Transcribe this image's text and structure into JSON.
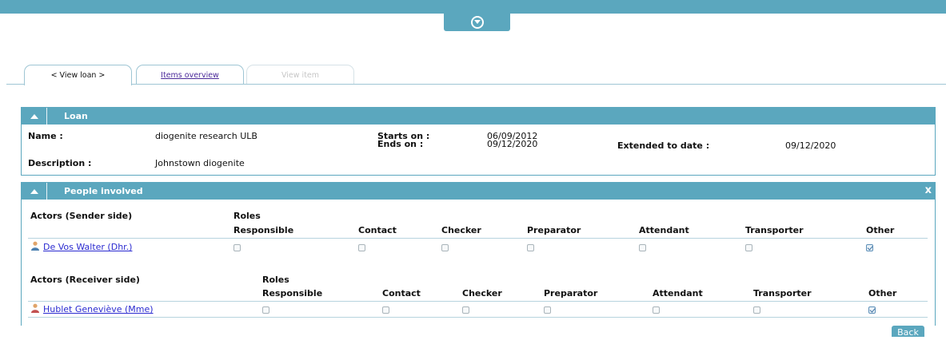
{
  "tabs": [
    {
      "label": "< View loan >"
    },
    {
      "label": "Items overview"
    },
    {
      "label": "View item"
    }
  ],
  "loan": {
    "title": "Loan",
    "name_label": "Name :",
    "name_value": "diogenite research ULB",
    "starts_label": "Starts on :",
    "starts_value": "06/09/2012",
    "ends_label": "Ends on :",
    "ends_value": "09/12/2020",
    "extended_label": "Extended to date :",
    "extended_value": "09/12/2020",
    "description_label": "Description :",
    "description_value": "Johnstown diogenite"
  },
  "people": {
    "title": "People involved",
    "close_label": "x",
    "roles_label": "Roles",
    "role_headers": [
      "Responsible",
      "Contact",
      "Checker",
      "Preparator",
      "Attendant",
      "Transporter",
      "Other"
    ],
    "sender": {
      "header": "Actors (Sender side)",
      "actor": "De Vos Walter (Dhr.)",
      "roles_checked": [
        false,
        false,
        false,
        false,
        false,
        false,
        true
      ]
    },
    "receiver": {
      "header": "Actors (Receiver side)",
      "actor": "Hublet Geneviève (Mme)",
      "roles_checked": [
        false,
        false,
        false,
        false,
        false,
        false,
        true
      ]
    }
  },
  "back_label": "Back",
  "icons": {
    "toggle": "chevron-down-circle-icon",
    "collapse": "triangle-up-icon",
    "person_male": "person-icon",
    "person_female": "person-icon"
  },
  "colors": {
    "accent": "#5ba7be",
    "link": "#2a2ad0",
    "tab_link": "#4b2a9a"
  }
}
